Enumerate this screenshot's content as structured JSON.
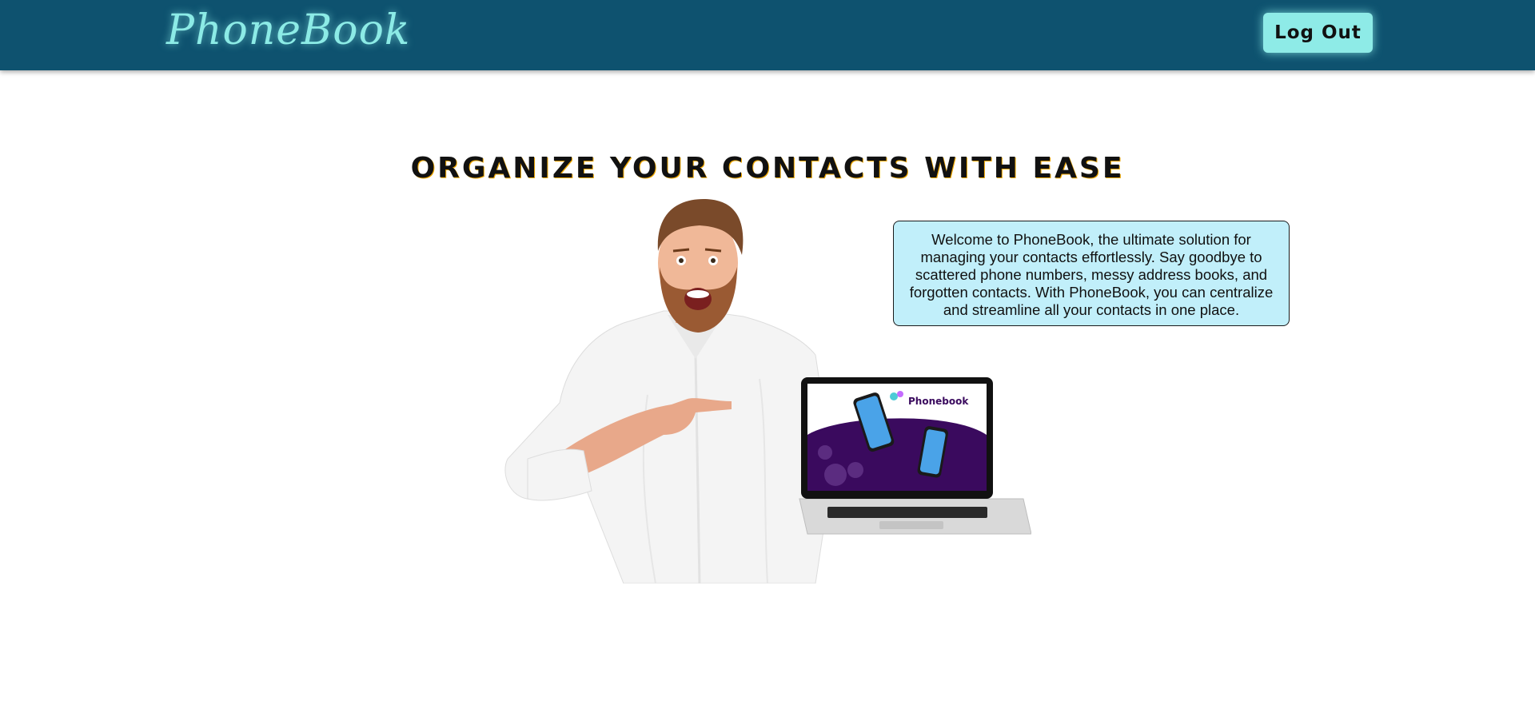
{
  "header": {
    "logo_text": "PhoneBook",
    "logout_label": "Log Out"
  },
  "main": {
    "headline": "ORGANIZE YOUR CONTACTS WITH EASE",
    "welcome_text": "Welcome to PhoneBook, the ultimate solution for managing your contacts effortlessly. Say goodbye to scattered phone numbers, messy address books, and forgotten contacts. With PhoneBook, you can centralize and streamline all your contacts in one place.",
    "hero_image": {
      "laptop_screen_brand": "Phonebook"
    }
  },
  "colors": {
    "header_bg": "#0e526f",
    "accent": "#8eebe7",
    "welcome_bg": "#c1effa",
    "laptop_purple": "#3a0a5e"
  }
}
